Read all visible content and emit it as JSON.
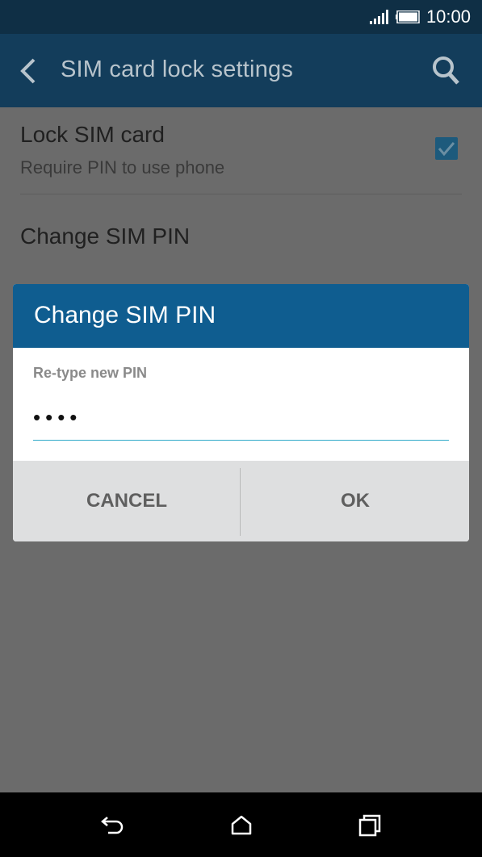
{
  "status_bar": {
    "time": "10:00"
  },
  "action_bar": {
    "title": "SIM card lock settings",
    "back_icon": "back-arrow-icon",
    "search_icon": "search-icon"
  },
  "settings": {
    "lock_sim": {
      "title": "Lock SIM card",
      "subtitle": "Require PIN to use phone",
      "checked": true
    },
    "change_pin": {
      "title": "Change SIM PIN"
    }
  },
  "dialog": {
    "title": "Change SIM PIN",
    "field_label": "Re-type new PIN",
    "field_value": "••••",
    "cancel_label": "CANCEL",
    "ok_label": "OK"
  },
  "nav_bar": {
    "icons": [
      "back-icon",
      "home-icon",
      "recent-apps-icon"
    ]
  },
  "colors": {
    "status_bar": "#0f2f45",
    "action_bar": "#133d5b",
    "dialog_header": "#0f5d90",
    "accent_line": "#2ea9c9",
    "checkbox": "#1d5a7c"
  }
}
